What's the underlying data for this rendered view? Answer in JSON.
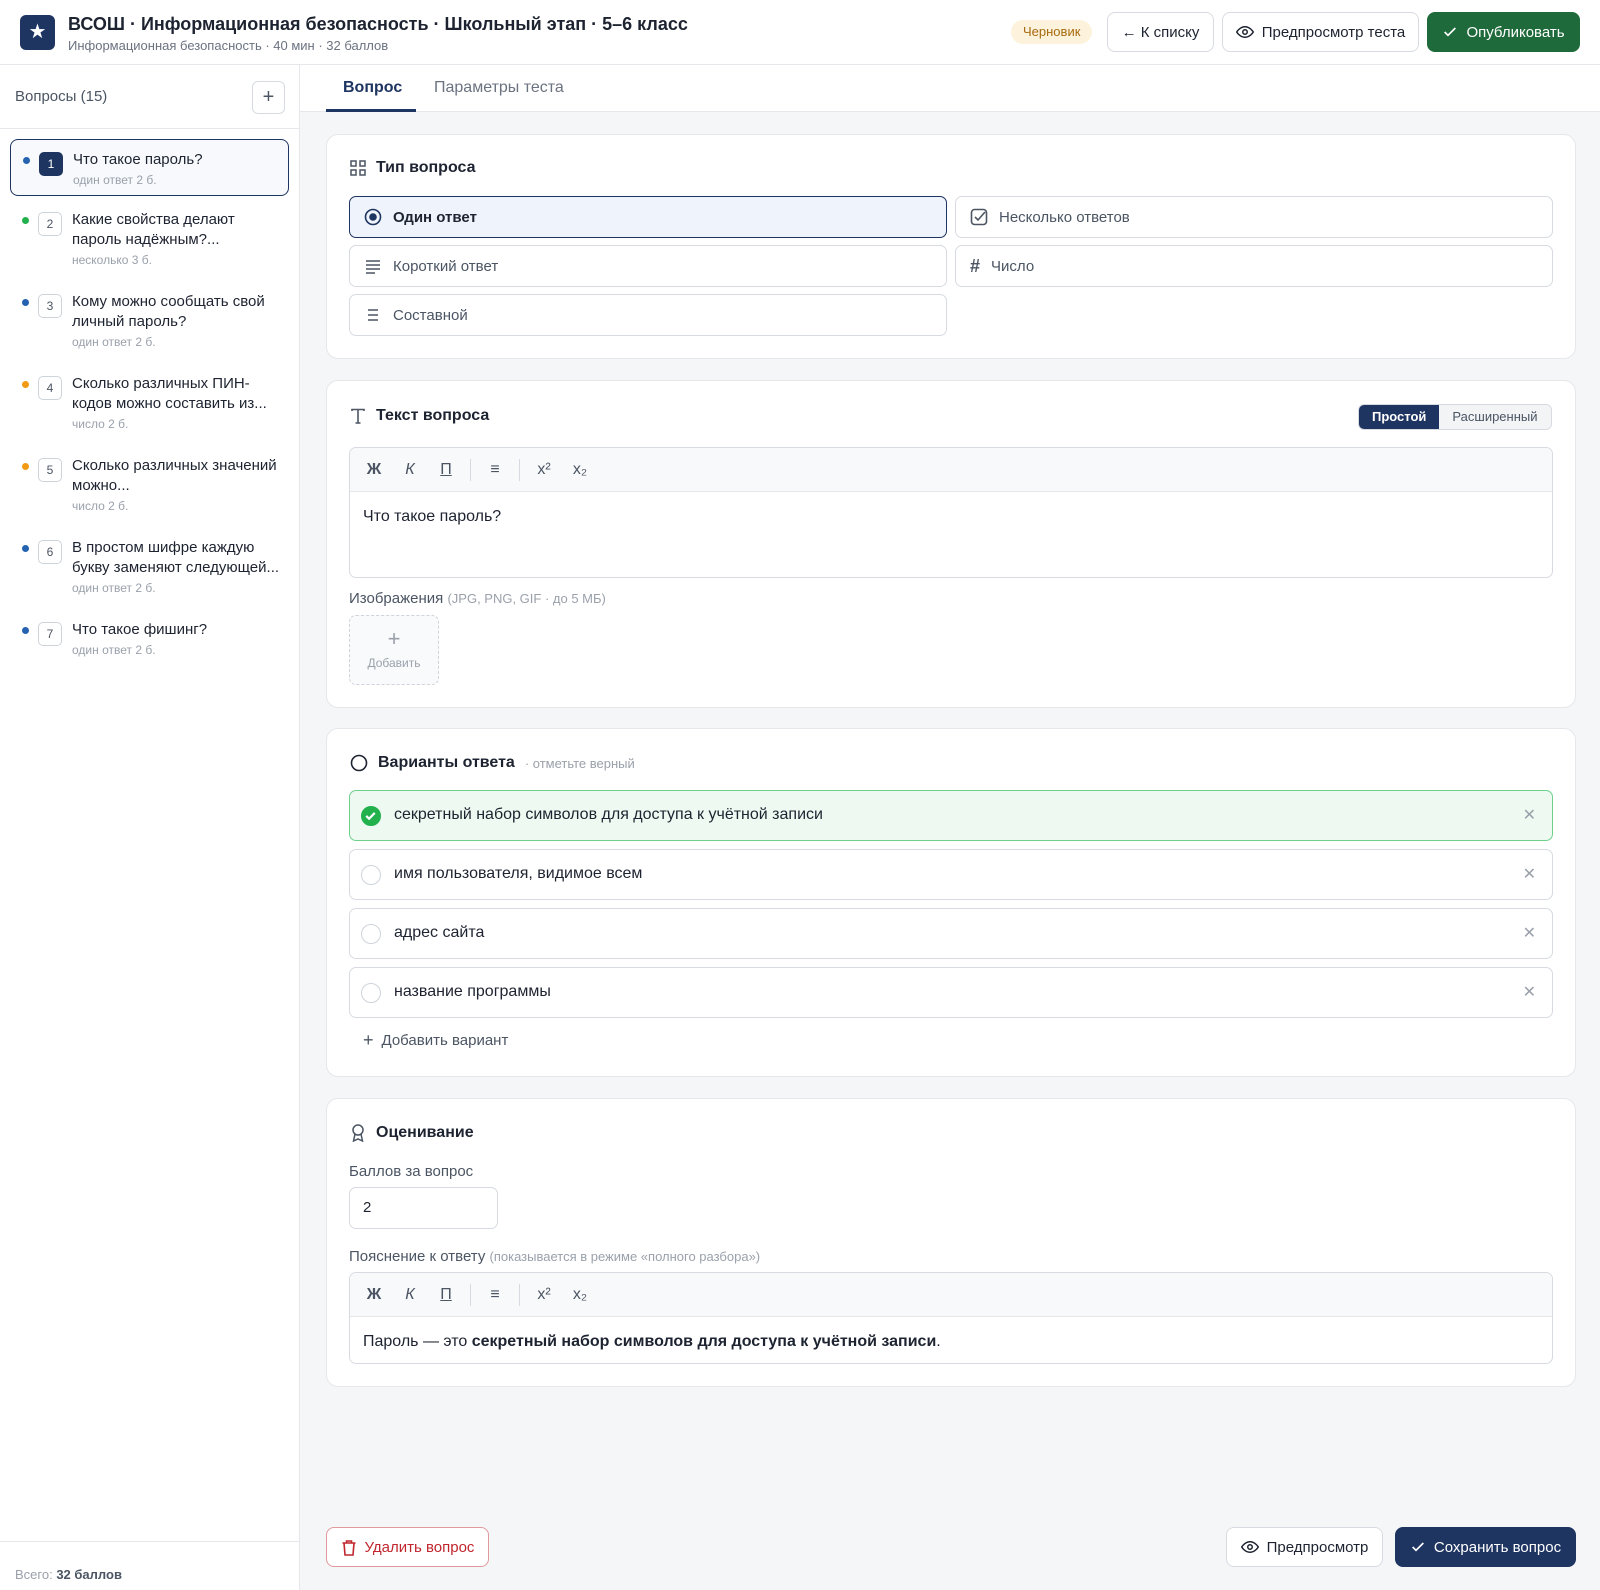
{
  "header": {
    "title": "ВСОШ · Информационная безопасность · Школьный этап · 5–6 класс",
    "subtitle": "Информационная безопасность · 40 мин · 32 баллов",
    "status": "Черновик",
    "back_label": "← К списку",
    "preview_label": "Предпросмотр теста",
    "publish_label": "Опубликовать"
  },
  "sidebar": {
    "title": "Вопросы (15)",
    "add_icon": "plus-icon",
    "items": [
      {
        "num": "1",
        "text": "Что такое пароль?",
        "meta": "один ответ  2 б.",
        "color": "#2563b0"
      },
      {
        "num": "2",
        "text": "Какие свойства делают пароль надёжным?...",
        "meta": "несколько  3 б.",
        "color": "#22b14c"
      },
      {
        "num": "3",
        "text": "Кому можно сообщать свой личный пароль?",
        "meta": "один ответ  2 б.",
        "color": "#2563b0"
      },
      {
        "num": "4",
        "text": "Сколько различных ПИН-кодов можно составить из...",
        "meta": "число  2 б.",
        "color": "#f29a13"
      },
      {
        "num": "5",
        "text": "Сколько различных значений можно...",
        "meta": "число  2 б.",
        "color": "#f29a13"
      },
      {
        "num": "6",
        "text": "В простом шифре каждую букву заменяют следующей...",
        "meta": "один ответ  2 б.",
        "color": "#2563b0"
      },
      {
        "num": "7",
        "text": "Что такое фишинг?",
        "meta": "один ответ  2 б.",
        "color": "#2563b0"
      }
    ],
    "footer_prefix": "Всего:",
    "footer_total": "32 баллов"
  },
  "tabs": [
    "Вопрос",
    "Параметры теста"
  ],
  "type_card": {
    "title": "Тип вопроса",
    "options": [
      {
        "label": "Один ответ",
        "icon": "radio-target-icon",
        "selected": true
      },
      {
        "label": "Несколько ответов",
        "icon": "checkbox-icon",
        "selected": false
      },
      {
        "label": "Короткий ответ",
        "icon": "text-lines-icon",
        "selected": false
      },
      {
        "label": "Число",
        "icon": "hash-icon",
        "selected": false
      },
      {
        "label": "Составной",
        "icon": "list-icon",
        "selected": false
      }
    ]
  },
  "text_card": {
    "title": "Текст вопроса",
    "modes": [
      "Простой",
      "Расширенный"
    ],
    "toolbar": [
      "Ж",
      "К",
      "П",
      "≡",
      "x²",
      "x₂"
    ],
    "content": "Что такое пароль?",
    "images_label": "Изображения",
    "images_hint": "(JPG, PNG, GIF · до 5 МБ)",
    "add_image_label": "Добавить"
  },
  "answers_card": {
    "title": "Варианты ответа",
    "hint": "· отметьте верный",
    "options": [
      {
        "text": "секретный набор символов для доступа к учётной записи",
        "correct": true
      },
      {
        "text": "имя пользователя, видимое всем",
        "correct": false
      },
      {
        "text": "адрес сайта",
        "correct": false
      },
      {
        "text": "название программы",
        "correct": false
      }
    ],
    "add_label": "Добавить вариант"
  },
  "grading_card": {
    "title": "Оценивание",
    "points_label": "Баллов за вопрос",
    "points_value": "2",
    "explain_label": "Пояснение к ответу",
    "explain_hint": "(показывается в режиме «полного разбора»)",
    "explain_prefix": "Пароль — это ",
    "explain_bold": "секретный набор символов для доступа к учётной записи",
    "explain_suffix": "."
  },
  "footer": {
    "delete_label": "Удалить вопрос",
    "preview_label": "Предпросмотр",
    "save_label": "Сохранить вопрос"
  },
  "colors": {
    "navy": "#1e3461",
    "green": "#1f6a3b",
    "correct": "#22b14c",
    "danger": "#c0262e"
  }
}
